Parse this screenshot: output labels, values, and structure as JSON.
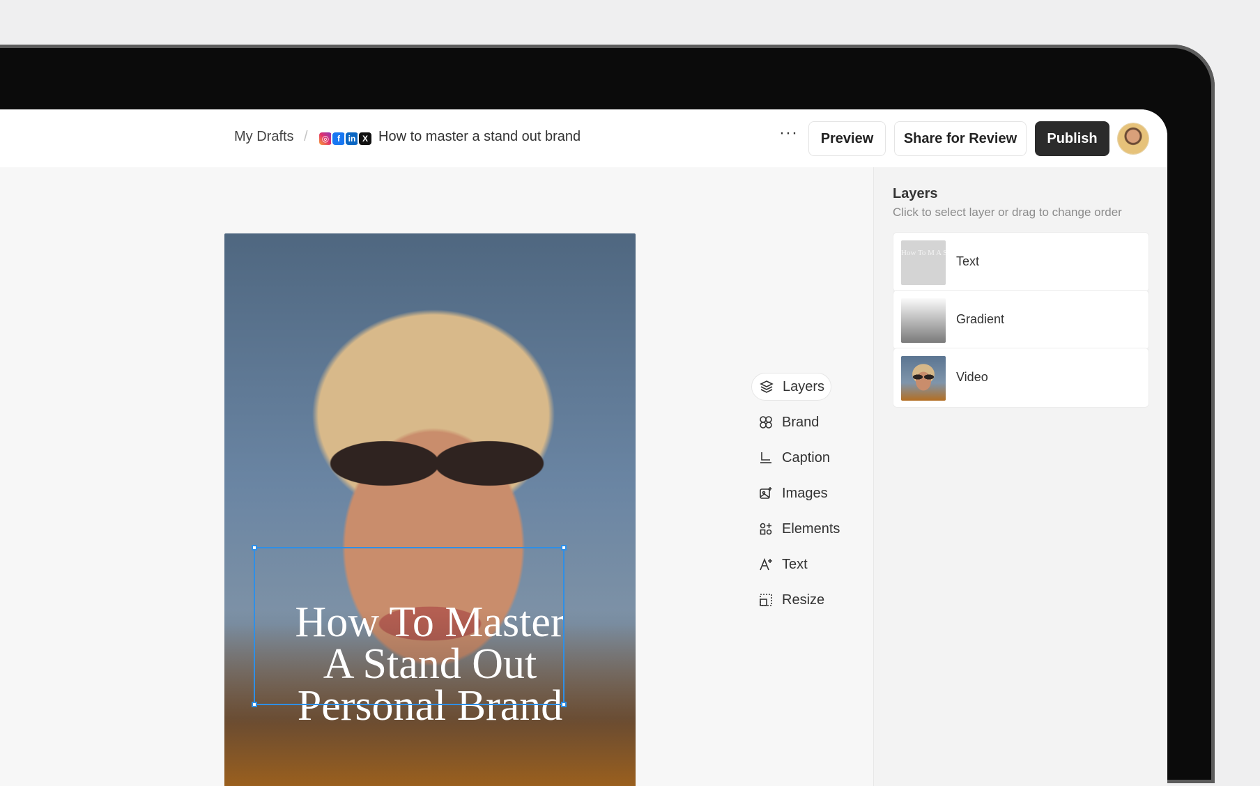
{
  "header": {
    "breadcrumb_root": "My Drafts",
    "breadcrumb_separator": "/",
    "social_icons": [
      "instagram-icon",
      "facebook-icon",
      "linkedin-icon",
      "x-icon"
    ],
    "document_title": "How to master a stand out brand",
    "more_label": "···",
    "preview_label": "Preview",
    "share_label": "Share for Review",
    "publish_label": "Publish"
  },
  "canvas": {
    "poster_lines": [
      "How To Master",
      "A Stand Out",
      "Personal Brand"
    ]
  },
  "tools": [
    {
      "label": "Layers",
      "icon": "layers-icon",
      "active": true
    },
    {
      "label": "Brand",
      "icon": "brand-icon",
      "active": false
    },
    {
      "label": "Caption",
      "icon": "caption-icon",
      "active": false
    },
    {
      "label": "Images",
      "icon": "images-icon",
      "active": false
    },
    {
      "label": "Elements",
      "icon": "elements-icon",
      "active": false
    },
    {
      "label": "Text",
      "icon": "text-icon",
      "active": false
    },
    {
      "label": "Resize",
      "icon": "resize-icon",
      "active": false
    }
  ],
  "layers_panel": {
    "title": "Layers",
    "subtitle": "Click to select layer or drag to change order",
    "items": [
      {
        "label": "Text",
        "thumb_text": "How To M A Stand O Personal B"
      },
      {
        "label": "Gradient"
      },
      {
        "label": "Video"
      }
    ]
  },
  "colors": {
    "accent_selection": "#2f8fe6",
    "publish_bg": "#2b2b2b"
  }
}
